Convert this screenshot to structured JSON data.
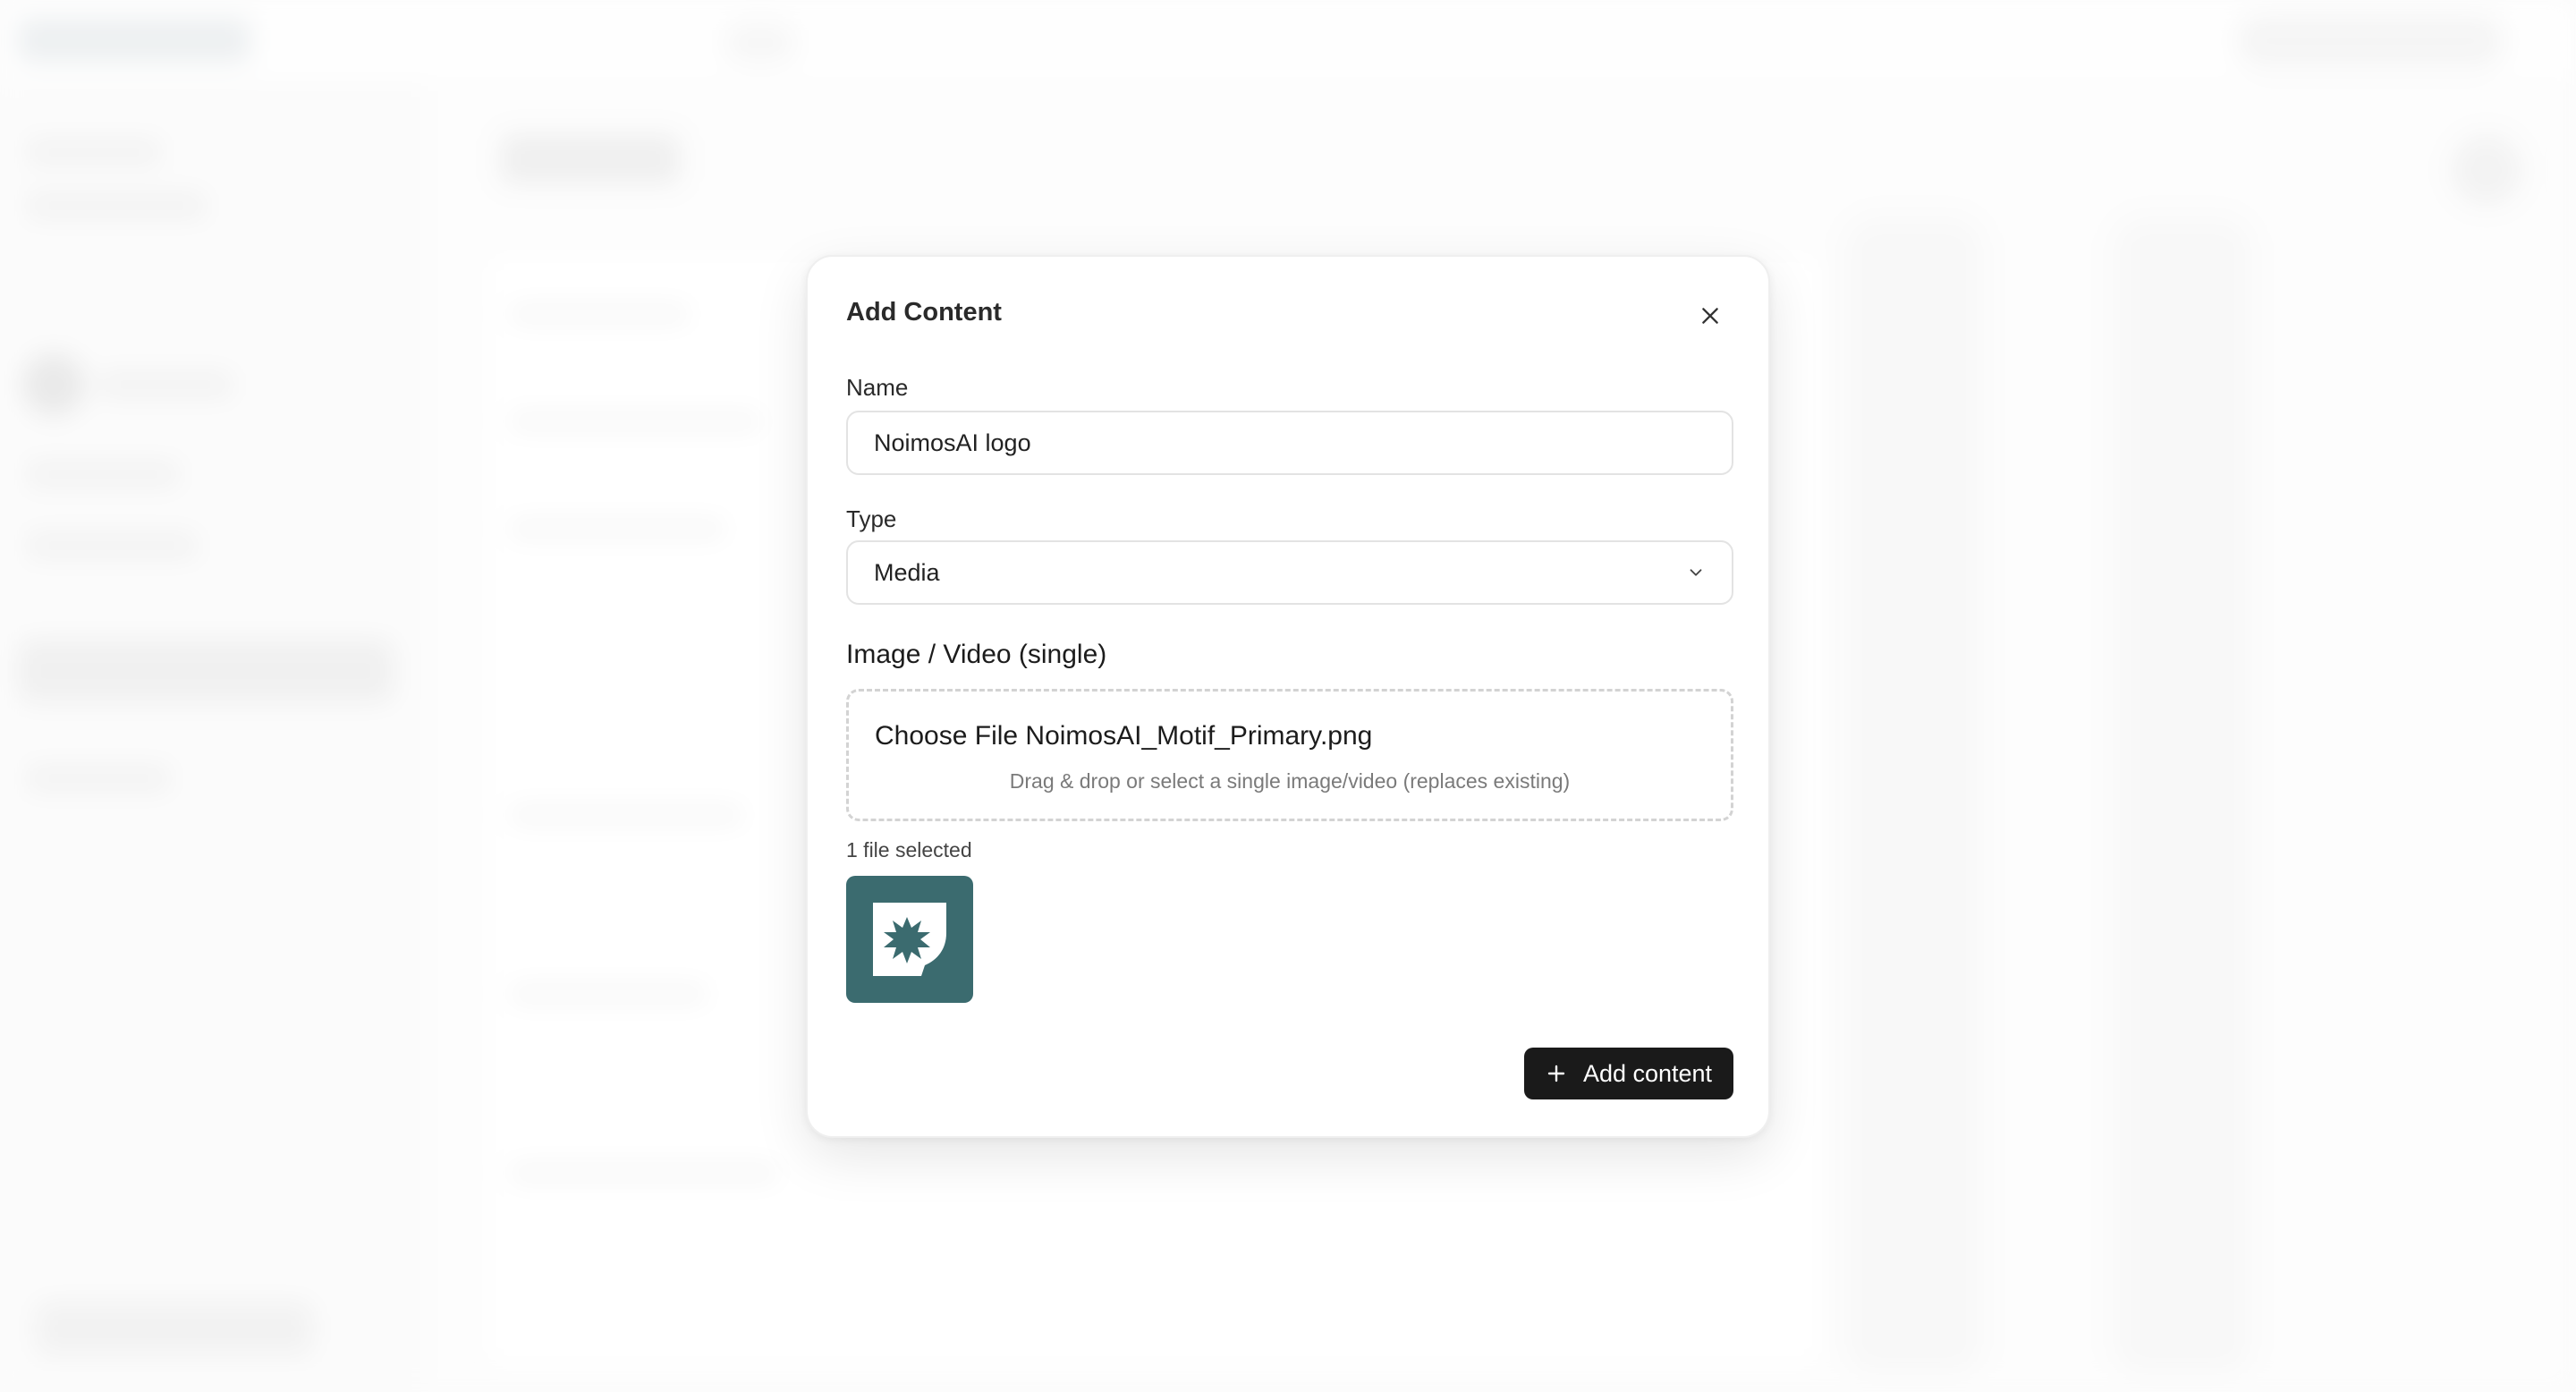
{
  "modal": {
    "title": "Add Content",
    "close_icon": "close-icon",
    "name_field": {
      "label": "Name",
      "value": "NoimosAI logo"
    },
    "type_field": {
      "label": "Type",
      "selected": "Media",
      "icon": "chevron-down-icon"
    },
    "upload": {
      "section_title": "Image / Video (single)",
      "choose_file_label": "Choose File",
      "file_name": "NoimosAI_Motif_Primary.png",
      "hint": "Drag & drop or select a single image/video (replaces existing)",
      "count_text": "1 file selected",
      "thumbnail_icon": "noimosai-logo-icon",
      "thumbnail_color": "#3b6b6f"
    },
    "submit": {
      "label": "Add content",
      "icon": "plus-icon"
    }
  },
  "colors": {
    "primary_button": "#1a1a1a",
    "thumbnail_bg": "#3b6b6f"
  }
}
